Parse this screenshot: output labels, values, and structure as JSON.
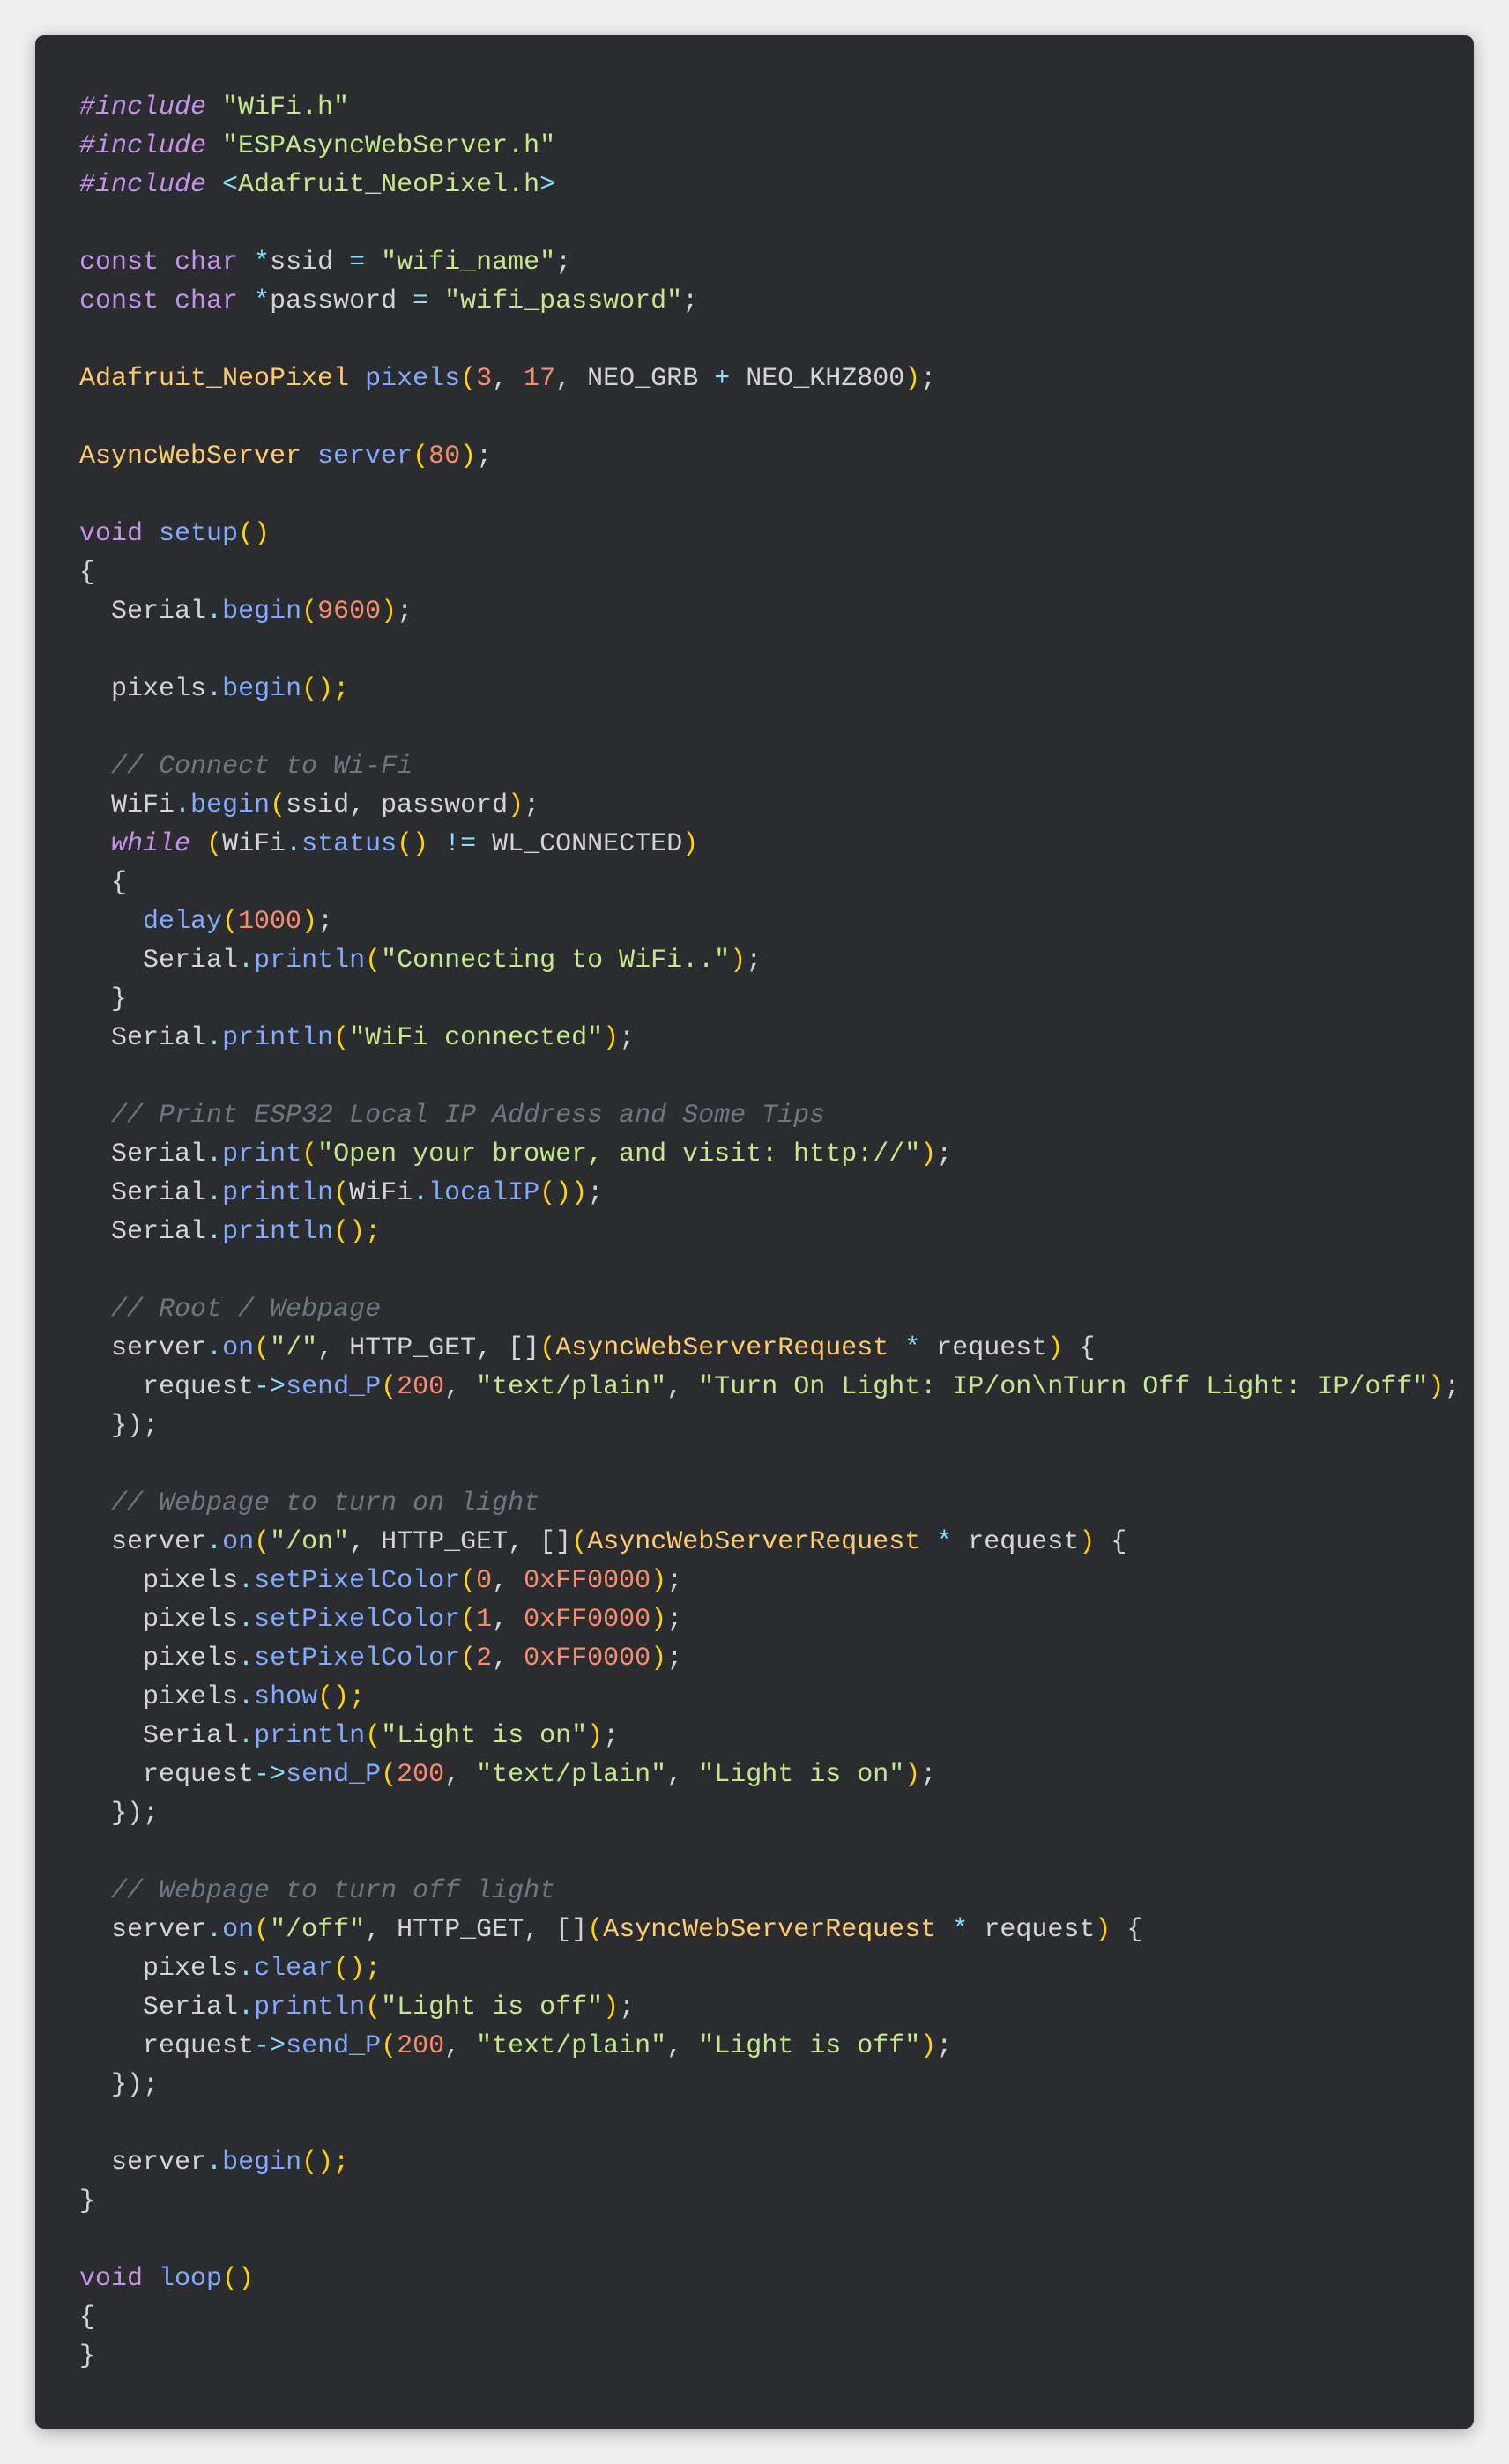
{
  "colors": {
    "background": "#2a2c30",
    "preproc": "#c792ea",
    "string": "#c3e88d",
    "keyword": "#c792ea",
    "class": "#ffcb6b",
    "func": "#82aaff",
    "num": "#f78c6c",
    "op": "#89ddff",
    "comment": "#6e7681",
    "default": "#d4d4d4"
  },
  "code": {
    "l1": {
      "inc": "#include ",
      "q1": "\"WiFi.h\""
    },
    "l2": {
      "inc": "#include ",
      "q1": "\"ESPAsyncWebServer.h\""
    },
    "l3": {
      "inc": "#include ",
      "lt": "<",
      "hdr": "Adafruit_NeoPixel.h",
      "gt": ">"
    },
    "l5": {
      "kw1": "const ",
      "kw2": "char ",
      "op": "*",
      "id": "ssid",
      "eq": " = ",
      "str": "\"wifi_name\"",
      "sc": ";"
    },
    "l6": {
      "kw1": "const ",
      "kw2": "char ",
      "op": "*",
      "id": "password",
      "eq": " = ",
      "str": "\"wifi_password\"",
      "sc": ";"
    },
    "l8": {
      "cls": "Adafruit_NeoPixel ",
      "fn": "pixels",
      "op": "(",
      "n1": "3",
      "c1": ", ",
      "n2": "17",
      "c2": ", ",
      "a": "NEO_GRB",
      "plus": " + ",
      "b": "NEO_KHZ800",
      "cp": ")",
      "sc": ";"
    },
    "l10": {
      "cls": "AsyncWebServer ",
      "fn": "server",
      "op": "(",
      "n": "80",
      "cp": ")",
      "sc": ";"
    },
    "l12": {
      "kw": "void ",
      "fn": "setup",
      "p": "()"
    },
    "l13": {
      "b": "{"
    },
    "l14": {
      "pad": "  ",
      "obj": "Serial",
      "dot": ".",
      "fn": "begin",
      "op": "(",
      "n": "9600",
      "cp": ")",
      "sc": ";"
    },
    "l16": {
      "pad": "  ",
      "obj": "pixels",
      "dot": ".",
      "fn": "begin",
      "p": "();"
    },
    "l18": {
      "pad": "  ",
      "c": "// Connect to Wi-Fi"
    },
    "l19": {
      "pad": "  ",
      "obj": "WiFi",
      "dot": ".",
      "fn": "begin",
      "op": "(",
      "a": "ssid",
      "c1": ", ",
      "b": "password",
      "cp": ")",
      "sc": ";"
    },
    "l20": {
      "pad": "  ",
      "kw": "while ",
      "op": "(",
      "obj": "WiFi",
      "dot": ".",
      "fn": "status",
      "p": "()",
      "ne": " != ",
      "c": "WL_CONNECTED",
      "cp": ")"
    },
    "l21": {
      "pad": "  ",
      "b": "{"
    },
    "l22": {
      "pad": "    ",
      "fn": "delay",
      "op": "(",
      "n": "1000",
      "cp": ")",
      "sc": ";"
    },
    "l23": {
      "pad": "    ",
      "obj": "Serial",
      "dot": ".",
      "fn": "println",
      "op": "(",
      "s": "\"Connecting to WiFi..\"",
      "cp": ")",
      "sc": ";"
    },
    "l24": {
      "pad": "  ",
      "b": "}"
    },
    "l25": {
      "pad": "  ",
      "obj": "Serial",
      "dot": ".",
      "fn": "println",
      "op": "(",
      "s": "\"WiFi connected\"",
      "cp": ")",
      "sc": ";"
    },
    "l27": {
      "pad": "  ",
      "c": "// Print ESP32 Local IP Address and Some Tips"
    },
    "l28": {
      "pad": "  ",
      "obj": "Serial",
      "dot": ".",
      "fn": "print",
      "op": "(",
      "s": "\"Open your brower, and visit: http://\"",
      "cp": ")",
      "sc": ";"
    },
    "l29": {
      "pad": "  ",
      "obj": "Serial",
      "dot": ".",
      "fn": "println",
      "op": "(",
      "obj2": "WiFi",
      "dot2": ".",
      "fn2": "localIP",
      "p2": "()",
      "cp": ")",
      "sc": ";"
    },
    "l30": {
      "pad": "  ",
      "obj": "Serial",
      "dot": ".",
      "fn": "println",
      "p": "();"
    },
    "l32": {
      "pad": "  ",
      "c": "// Root / Webpage"
    },
    "l33": {
      "pad": "  ",
      "obj": "server",
      "dot": ".",
      "fn": "on",
      "op": "(",
      "s": "\"/\"",
      "c1": ", ",
      "h": "HTTP_GET",
      "c2": ", ",
      "lb": "[]",
      "op2": "(",
      "cls": "AsyncWebServerRequest ",
      "st": "* ",
      "v": "request",
      "cp2": ")",
      "ob": " {"
    },
    "l34": {
      "pad": "    ",
      "obj": "request",
      "arr": "->",
      "fn": "send_P",
      "op": "(",
      "n": "200",
      "c1": ", ",
      "s1": "\"text/plain\"",
      "c2": ", ",
      "s2": "\"Turn On Light: IP/on\\nTurn Off Light: IP/off\"",
      "cp": ")",
      "sc": ";"
    },
    "l35": {
      "pad": "  ",
      "b": "});"
    },
    "l37": {
      "pad": "  ",
      "c": "// Webpage to turn on light"
    },
    "l38": {
      "pad": "  ",
      "obj": "server",
      "dot": ".",
      "fn": "on",
      "op": "(",
      "s": "\"/on\"",
      "c1": ", ",
      "h": "HTTP_GET",
      "c2": ", ",
      "lb": "[]",
      "op2": "(",
      "cls": "AsyncWebServerRequest ",
      "st": "* ",
      "v": "request",
      "cp2": ")",
      "ob": " {"
    },
    "l39": {
      "pad": "    ",
      "obj": "pixels",
      "dot": ".",
      "fn": "setPixelColor",
      "op": "(",
      "n": "0",
      "c1": ", ",
      "hx": "0xFF0000",
      "cp": ")",
      "sc": ";"
    },
    "l40": {
      "pad": "    ",
      "obj": "pixels",
      "dot": ".",
      "fn": "setPixelColor",
      "op": "(",
      "n": "1",
      "c1": ", ",
      "hx": "0xFF0000",
      "cp": ")",
      "sc": ";"
    },
    "l41": {
      "pad": "    ",
      "obj": "pixels",
      "dot": ".",
      "fn": "setPixelColor",
      "op": "(",
      "n": "2",
      "c1": ", ",
      "hx": "0xFF0000",
      "cp": ")",
      "sc": ";"
    },
    "l42": {
      "pad": "    ",
      "obj": "pixels",
      "dot": ".",
      "fn": "show",
      "p": "();"
    },
    "l43": {
      "pad": "    ",
      "obj": "Serial",
      "dot": ".",
      "fn": "println",
      "op": "(",
      "s": "\"Light is on\"",
      "cp": ")",
      "sc": ";"
    },
    "l44": {
      "pad": "    ",
      "obj": "request",
      "arr": "->",
      "fn": "send_P",
      "op": "(",
      "n": "200",
      "c1": ", ",
      "s1": "\"text/plain\"",
      "c2": ", ",
      "s2": "\"Light is on\"",
      "cp": ")",
      "sc": ";"
    },
    "l45": {
      "pad": "  ",
      "b": "});"
    },
    "l47": {
      "pad": "  ",
      "c": "// Webpage to turn off light"
    },
    "l48": {
      "pad": "  ",
      "obj": "server",
      "dot": ".",
      "fn": "on",
      "op": "(",
      "s": "\"/off\"",
      "c1": ", ",
      "h": "HTTP_GET",
      "c2": ", ",
      "lb": "[]",
      "op2": "(",
      "cls": "AsyncWebServerRequest ",
      "st": "* ",
      "v": "request",
      "cp2": ")",
      "ob": " {"
    },
    "l49": {
      "pad": "    ",
      "obj": "pixels",
      "dot": ".",
      "fn": "clear",
      "p": "();"
    },
    "l50": {
      "pad": "    ",
      "obj": "Serial",
      "dot": ".",
      "fn": "println",
      "op": "(",
      "s": "\"Light is off\"",
      "cp": ")",
      "sc": ";"
    },
    "l51": {
      "pad": "    ",
      "obj": "request",
      "arr": "->",
      "fn": "send_P",
      "op": "(",
      "n": "200",
      "c1": ", ",
      "s1": "\"text/plain\"",
      "c2": ", ",
      "s2": "\"Light is off\"",
      "cp": ")",
      "sc": ";"
    },
    "l52": {
      "pad": "  ",
      "b": "});"
    },
    "l54": {
      "pad": "  ",
      "obj": "server",
      "dot": ".",
      "fn": "begin",
      "p": "();"
    },
    "l55": {
      "b": "}"
    },
    "l57": {
      "kw": "void ",
      "fn": "loop",
      "p": "()"
    },
    "l58": {
      "b": "{"
    },
    "l59": {
      "b": "}"
    }
  }
}
